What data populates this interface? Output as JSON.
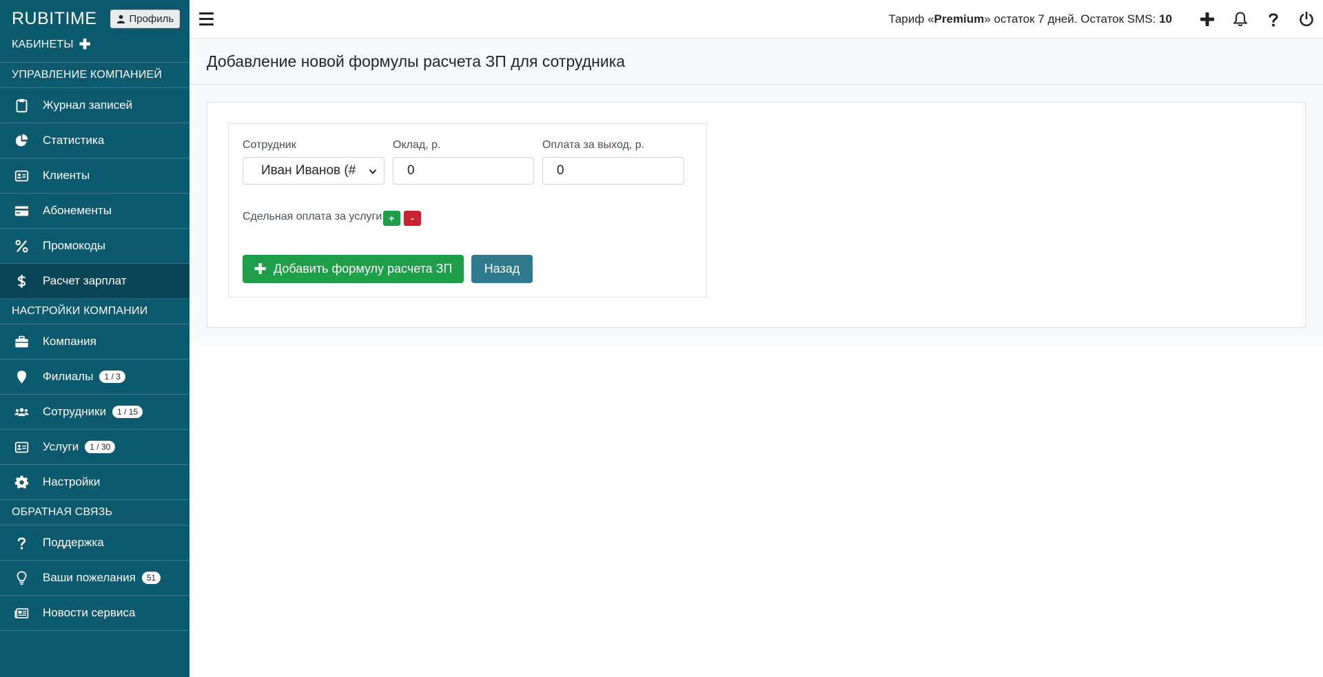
{
  "brand": "RUBITIME",
  "profile_label": "Профиль",
  "sidebar": {
    "cabinets_label": "КАБИНЕТЫ",
    "sections": [
      {
        "title": "УПРАВЛЕНИЕ КОМПАНИЕЙ",
        "items": [
          {
            "label": "Журнал записей",
            "icon": "clipboard-icon"
          },
          {
            "label": "Статистика",
            "icon": "pie-chart-icon"
          },
          {
            "label": "Клиенты",
            "icon": "id-card-icon"
          },
          {
            "label": "Абонементы",
            "icon": "credit-card-icon"
          },
          {
            "label": "Промокоды",
            "icon": "percent-icon"
          },
          {
            "label": "Расчет зарплат",
            "icon": "dollar-icon",
            "active": true
          }
        ]
      },
      {
        "title": "НАСТРОЙКИ КОМПАНИИ",
        "items": [
          {
            "label": "Компания",
            "icon": "briefcase-icon"
          },
          {
            "label": "Филиалы",
            "icon": "map-marker-icon",
            "badge": "1 / 3"
          },
          {
            "label": "Сотрудники",
            "icon": "users-icon",
            "badge": "1 / 15"
          },
          {
            "label": "Услуги",
            "icon": "id-card-icon",
            "badge": "1 / 30"
          },
          {
            "label": "Настройки",
            "icon": "gear-icon"
          }
        ]
      },
      {
        "title": "ОБРАТНАЯ СВЯЗЬ",
        "items": [
          {
            "label": "Поддержка",
            "icon": "question-icon"
          },
          {
            "label": "Ваши пожелания",
            "icon": "lightbulb-icon",
            "badge": "51"
          },
          {
            "label": "Новости сервиса",
            "icon": "newspaper-icon"
          }
        ]
      }
    ]
  },
  "topbar": {
    "tariff_prefix": "Тариф «",
    "tariff_name": "Premium",
    "tariff_suffix": "» остаток 7 дней. Остаток SMS: ",
    "sms_count": "10"
  },
  "page": {
    "title": "Добавление новой формулы расчета ЗП для сотрудника"
  },
  "form": {
    "employee_label": "Сотрудник",
    "employee_value": "Иван Иванов (#",
    "salary_label": "Оклад, р.",
    "salary_value": "0",
    "shift_label": "Оплата за выход, р.",
    "shift_value": "0",
    "piece_label": "Сдельная оплата за услуги",
    "plus_label": "+",
    "minus_label": "-",
    "add_button": "Добавить формулу расчета ЗП",
    "back_button": "Назад"
  },
  "colors": {
    "sidebar_bg": "#0c5a6e",
    "sidebar_active": "#0a4557",
    "success": "#1e9e48",
    "danger": "#c82333",
    "info": "#2e7a8c"
  }
}
